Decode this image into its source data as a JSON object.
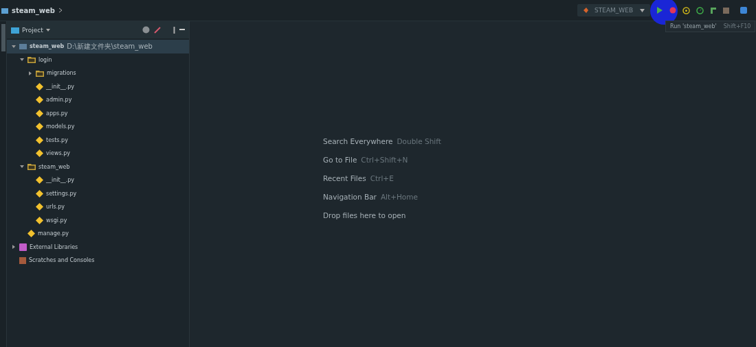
{
  "title_bar": {
    "project_name": "steam_web",
    "run_config": "STEAM_WEB",
    "tooltip": "Run 'steam_web'",
    "tooltip_shortcut": "Shift+F10"
  },
  "project_panel": {
    "title": "Project",
    "tree": [
      {
        "kind": "module",
        "name": "steam_web",
        "path": "D:\\新建文件夹\\steam_web",
        "expanded": true,
        "selected": true,
        "children": [
          {
            "kind": "folder",
            "name": "login",
            "expanded": true,
            "selected": false,
            "children": [
              {
                "kind": "folder",
                "name": "migrations",
                "expanded": false,
                "selected": false
              },
              {
                "kind": "file",
                "name": "__init__.py",
                "selected": false
              },
              {
                "kind": "file",
                "name": "admin.py",
                "selected": false
              },
              {
                "kind": "file",
                "name": "apps.py",
                "selected": false
              },
              {
                "kind": "file",
                "name": "models.py",
                "selected": false
              },
              {
                "kind": "file",
                "name": "tests.py",
                "selected": false
              },
              {
                "kind": "file",
                "name": "views.py",
                "selected": false
              }
            ]
          },
          {
            "kind": "folder",
            "name": "steam_web",
            "expanded": true,
            "selected": false,
            "children": [
              {
                "kind": "file",
                "name": "__init__.py",
                "selected": false
              },
              {
                "kind": "file",
                "name": "settings.py",
                "selected": false
              },
              {
                "kind": "file",
                "name": "urls.py",
                "selected": false
              },
              {
                "kind": "file",
                "name": "wsgi.py",
                "selected": false
              }
            ]
          },
          {
            "kind": "file",
            "name": "manage.py",
            "selected": false
          }
        ]
      },
      {
        "kind": "libraries",
        "name": "External Libraries",
        "expanded": false,
        "selected": false
      },
      {
        "kind": "scratches",
        "name": "Scratches and Consoles",
        "selected": false
      }
    ]
  },
  "editor_hints": [
    {
      "action": "Search Everywhere",
      "shortcut": "Double Shift"
    },
    {
      "action": "Go to File",
      "shortcut": "Ctrl+Shift+N"
    },
    {
      "action": "Recent Files",
      "shortcut": "Ctrl+E"
    },
    {
      "action": "Navigation Bar",
      "shortcut": "Alt+Home"
    },
    {
      "action": "Drop files here to open"
    }
  ]
}
